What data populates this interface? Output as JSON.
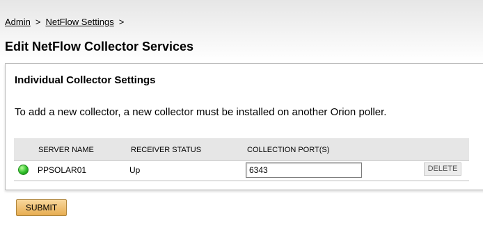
{
  "breadcrumb": {
    "items": [
      "Admin",
      "NetFlow Settings"
    ],
    "separator": ">"
  },
  "page": {
    "title": "Edit NetFlow Collector Services"
  },
  "panel": {
    "title": "Individual Collector Settings",
    "note": "To add a new collector, a new collector must be installed on another Orion poller."
  },
  "grid": {
    "columns": [
      "SERVER NAME",
      "RECEIVER STATUS",
      "COLLECTION PORT(S)"
    ],
    "rows": [
      {
        "status_icon": "green-status-icon",
        "server_name": "PPSOLAR01",
        "receiver_status": "Up",
        "collection_ports": "6343",
        "delete_label": "DELETE"
      }
    ]
  },
  "actions": {
    "submit_label": "SUBMIT"
  },
  "colors": {
    "status_up": "#2fbf2a",
    "submit_bg": "#e7ad52"
  }
}
